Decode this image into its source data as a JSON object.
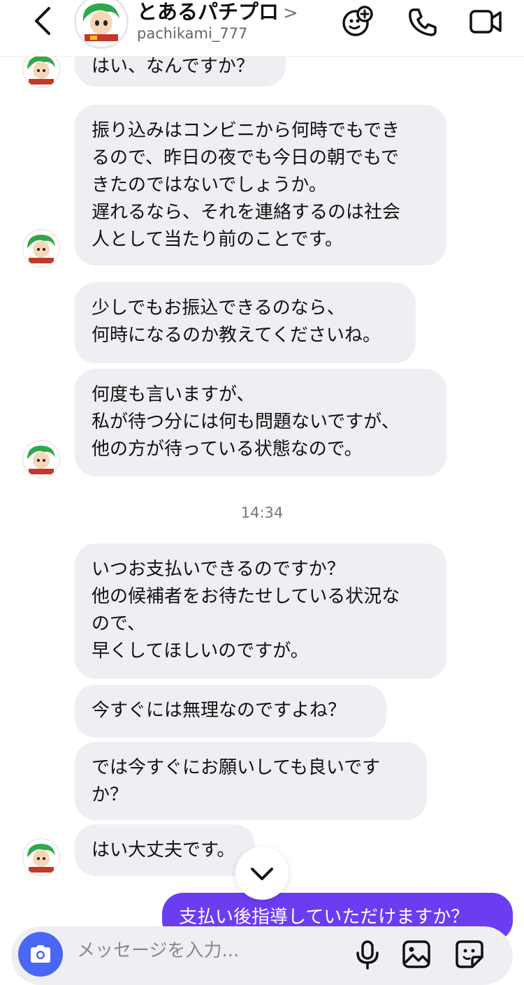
{
  "header": {
    "name": "とあるパチプロ",
    "chevron": ">",
    "username": "pachikami_777"
  },
  "messages": [
    {
      "text": "はい、なんですか？"
    },
    {
      "text": "振り込みはコンビニから何時でもでき\nるので、昨日の夜でも今日の朝でもで\nきたのではないでしょうか。\n遅れるなら、それを連絡するのは社会\n人として当たり前のことです。"
    },
    {
      "text": "少しでもお振込できるのなら、\n何時になるのか教えてくださいね。"
    },
    {
      "text": "何度も言いますが、\n私が待つ分には何も問題ないですが、\n他の方が待っている状態なので。"
    },
    {
      "text": "いつお支払いできるのですか？\n他の候補者をお待たせしている状況な\nので、\n早くしてほしいのですが。"
    },
    {
      "text": "今すぐには無理なのですよね？"
    },
    {
      "text": "では今すぐにお願いしても良いです\nか？"
    },
    {
      "text": "はい大丈夫です。"
    }
  ],
  "timestamp": "14:34",
  "my_message": {
    "text": "支払い後指導していただけますか？"
  },
  "composer": {
    "placeholder": "メッセージを入力..."
  },
  "icons": {
    "back": "chevron-left-icon",
    "add_person": "add-person-icon",
    "call": "phone-icon",
    "video": "video-camera-icon",
    "camera": "camera-icon",
    "mic": "microphone-icon",
    "gallery": "image-icon",
    "sticker": "sticker-icon",
    "scroll": "chevron-down-icon"
  },
  "colors": {
    "accent": "#6c3cf1",
    "camera": "#4a66f5",
    "bubble": "#efeff3"
  }
}
